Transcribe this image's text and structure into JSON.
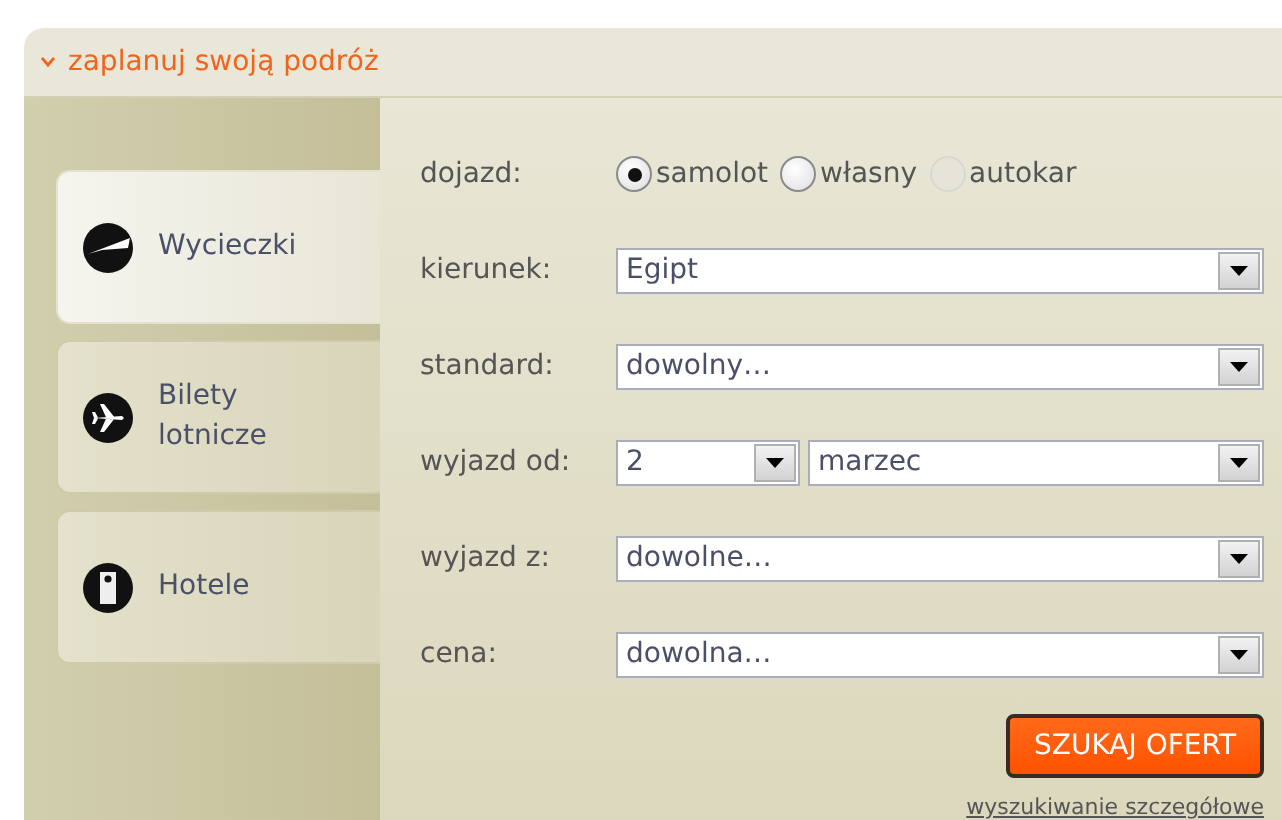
{
  "header": {
    "title": "zaplanuj swoją podróż"
  },
  "tabs": [
    {
      "kind": "trips",
      "label": "Wycieczki",
      "selected": true
    },
    {
      "kind": "flights",
      "label": "Bilety lotnicze",
      "selected": false
    },
    {
      "kind": "hotels",
      "label": "Hotele",
      "selected": false
    }
  ],
  "fields": [
    {
      "kind": "radio",
      "label": "dojazd:",
      "options": [
        {
          "label": "samolot",
          "selected": true,
          "disabled": false
        },
        {
          "label": "własny",
          "selected": false,
          "disabled": false
        },
        {
          "label": "autokar",
          "selected": false,
          "disabled": true
        }
      ]
    },
    {
      "kind": "select",
      "label": "kierunek:",
      "value": "Egipt"
    },
    {
      "kind": "select",
      "label": "standard:",
      "value": "dowolny…"
    },
    {
      "kind": "date",
      "label": "wyjazd od:",
      "day": "2",
      "month": "marzec"
    },
    {
      "kind": "select",
      "label": "wyjazd z:",
      "value": "dowolne…"
    },
    {
      "kind": "select",
      "label": "cena:",
      "value": "dowolna…"
    }
  ],
  "search_button": "SZUKAJ OFERT",
  "advanced_link": "wyszukiwanie szczegółowe"
}
